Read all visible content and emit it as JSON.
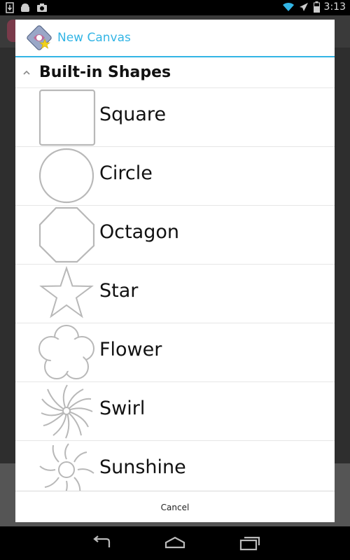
{
  "status_bar": {
    "time": "3:13",
    "left_icons": [
      "download-icon",
      "android-icon",
      "camera-icon"
    ],
    "right_icons": [
      "wifi-icon",
      "airplane-icon",
      "battery-icon"
    ]
  },
  "dialog": {
    "title": "New Canvas",
    "group_title": "Built-in Shapes",
    "shapes": [
      {
        "label": "Square",
        "icon": "square-icon"
      },
      {
        "label": "Circle",
        "icon": "circle-icon"
      },
      {
        "label": "Octagon",
        "icon": "octagon-icon"
      },
      {
        "label": "Star",
        "icon": "star-icon"
      },
      {
        "label": "Flower",
        "icon": "flower-icon"
      },
      {
        "label": "Swirl",
        "icon": "swirl-icon"
      },
      {
        "label": "Sunshine",
        "icon": "sunshine-icon"
      }
    ],
    "cancel_label": "Cancel"
  },
  "nav_bar": [
    "back-icon",
    "home-icon",
    "recent-apps-icon"
  ],
  "colors": {
    "accent": "#33b5e5",
    "shape_stroke": "#b8b8b8"
  }
}
